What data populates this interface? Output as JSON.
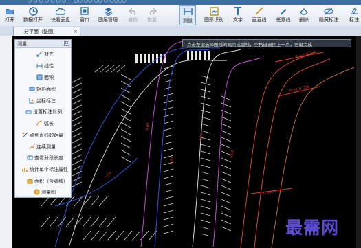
{
  "window": {
    "title": "○ ○ ○ ○ ○ ○ ○ — ○○ ○○ ○○ ○ ○○○○"
  },
  "toolbar": {
    "items": [
      {
        "label": "打开",
        "icon": "folder-open-icon"
      },
      {
        "label": "数据打开",
        "icon": "clock-icon"
      },
      {
        "label": "快看云盘",
        "icon": "cloud-icon"
      },
      {
        "label": "窗口",
        "icon": "window-icon"
      },
      {
        "label": "图层管理",
        "icon": "layers-icon"
      },
      {
        "label": "撤销",
        "icon": "undo-icon"
      },
      {
        "label": "恢复",
        "icon": "redo-icon"
      },
      {
        "label": "测量",
        "icon": "measure-icon"
      },
      {
        "label": "图形识别",
        "icon": "image-recognize-icon"
      },
      {
        "label": "文字",
        "icon": "text-icon"
      },
      {
        "label": "画直线",
        "icon": "line-icon"
      },
      {
        "label": "任意线",
        "icon": "pencil-icon"
      },
      {
        "label": "删除",
        "icon": "eraser-icon"
      },
      {
        "label": "隐藏标注",
        "icon": "hide-icon"
      },
      {
        "label": "标注",
        "icon": "annotate-icon"
      }
    ]
  },
  "tab": {
    "label": "分平面（整图）",
    "close": "×"
  },
  "panel": {
    "title": "测量",
    "pin": "⊟",
    "items": [
      {
        "label": "对齐",
        "icon": "align-icon"
      },
      {
        "label": "线性",
        "icon": "linear-icon"
      },
      {
        "label": "面积",
        "icon": "area-icon"
      },
      {
        "label": "矩形面积",
        "icon": "rect-area-icon"
      },
      {
        "label": "坐标标注",
        "icon": "coordinate-icon"
      },
      {
        "label": "设置标注比例",
        "icon": "scale-icon"
      },
      {
        "label": "弧长",
        "icon": "arc-icon"
      },
      {
        "label": "点到直线的距离",
        "icon": "point-line-icon"
      },
      {
        "label": "连续测量",
        "icon": "continuous-icon"
      },
      {
        "label": "查看分段长度",
        "icon": "segment-icon"
      },
      {
        "label": "统计单个标注属性",
        "icon": "stats-icon"
      },
      {
        "label": "面积（含弧线）",
        "icon": "arc-area-icon"
      },
      {
        "label": "测量图",
        "icon": "measure-map-icon"
      }
    ]
  },
  "tooltip": {
    "text": "点击左键选择图线的端点或弧线，空格键退回上一点，右键完成"
  },
  "drawing": {
    "labels": [
      "XL=105.178",
      "XL=101.256",
      "XL=174.163",
      "6.00",
      "6.00",
      "5.00",
      "6.00",
      "6.00"
    ]
  },
  "watermark": {
    "text": "最需网"
  },
  "colors": {
    "accent": "#2f6fb5",
    "canvas": "#000000"
  }
}
